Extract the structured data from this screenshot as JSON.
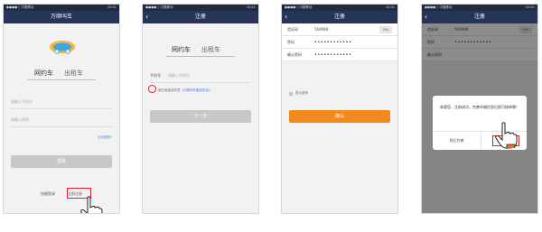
{
  "statusbar": {
    "carrier": "●●●●○ 中国移动",
    "time": "10:41"
  },
  "screen1": {
    "nav_title": "万顺叫车",
    "tabs": [
      "网约车",
      "出租车"
    ],
    "phone_placeholder": "请输入手机号",
    "password_placeholder": "请输入密码",
    "forgot_link": "忘记密码?",
    "login_button": "登录",
    "quick_login": "快捷登录",
    "register_now": "立即注册"
  },
  "screen2": {
    "nav_title": "注册",
    "tabs": [
      "网约车",
      "出租车"
    ],
    "phone_label": "手机号",
    "phone_placeholder": "请输入手机号",
    "agree_text": "我已阅读并同意",
    "agree_link": "《万顺叫车服务协议》",
    "next_button": "下一步"
  },
  "screen3": {
    "nav_title": "注册",
    "code_label": "验证码",
    "code_value": "568988",
    "code_chip": "59s",
    "password_label": "密码",
    "password_value": "••••••••••••",
    "confirm_label": "确认密码",
    "confirm_value": "••••••••••••",
    "show_password": "显示密码",
    "confirm_button": "确认"
  },
  "screen4": {
    "nav_title": "注册",
    "code_label": "验证码",
    "code_value": "568988",
    "code_chip": "59s",
    "password_label": "密码",
    "password_value": "••••••••••••",
    "confirm_label": "确认密码",
    "dialog_message": "恭喜您，注册成功，完善车辆信息后即可接单哦！",
    "later_button": "稍后完善",
    "complete_button": "完善信息"
  },
  "colors": {
    "navbar": "#263457",
    "accent": "#f28a1e",
    "highlight": "#d9232d",
    "link": "#3a7bd5"
  }
}
